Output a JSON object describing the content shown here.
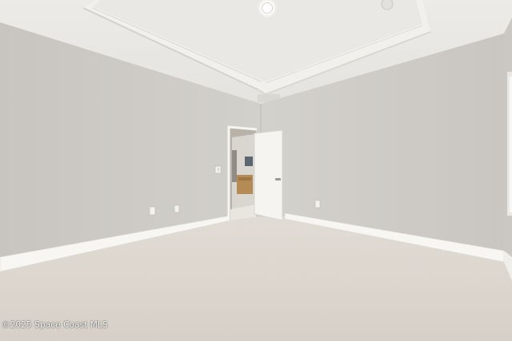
{
  "photo": {
    "subject": "empty carpeted bedroom"
  },
  "watermark": {
    "text": "©2025 Space Coast MLS"
  }
}
